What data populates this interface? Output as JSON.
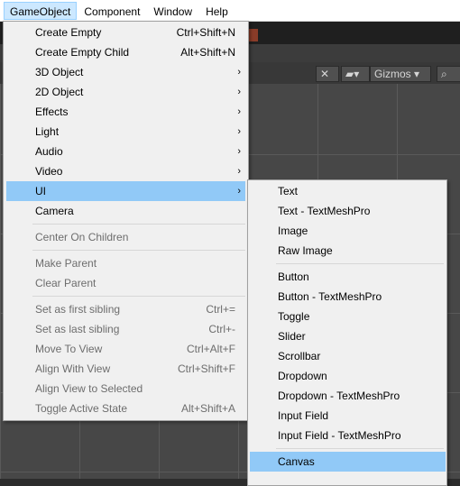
{
  "menubar": {
    "items": [
      "GameObject",
      "Component",
      "Window",
      "Help"
    ]
  },
  "scene": {
    "gizmos_label": "Gizmos"
  },
  "menu": {
    "items": [
      {
        "label": "Create Empty",
        "shortcut": "Ctrl+Shift+N"
      },
      {
        "label": "Create Empty Child",
        "shortcut": "Alt+Shift+N"
      },
      {
        "label": "3D Object",
        "submenu": true
      },
      {
        "label": "2D Object",
        "submenu": true
      },
      {
        "label": "Effects",
        "submenu": true
      },
      {
        "label": "Light",
        "submenu": true
      },
      {
        "label": "Audio",
        "submenu": true
      },
      {
        "label": "Video",
        "submenu": true
      },
      {
        "label": "UI",
        "submenu": true,
        "highlighted": true
      },
      {
        "label": "Camera"
      },
      {
        "label": "Center On Children",
        "disabled": true
      },
      {
        "label": "Make Parent",
        "disabled": true
      },
      {
        "label": "Clear Parent",
        "disabled": true
      },
      {
        "label": "Set as first sibling",
        "shortcut": "Ctrl+=",
        "disabled": true
      },
      {
        "label": "Set as last sibling",
        "shortcut": "Ctrl+-",
        "disabled": true
      },
      {
        "label": "Move To View",
        "shortcut": "Ctrl+Alt+F",
        "disabled": true
      },
      {
        "label": "Align With View",
        "shortcut": "Ctrl+Shift+F",
        "disabled": true
      },
      {
        "label": "Align View to Selected",
        "disabled": true
      },
      {
        "label": "Toggle Active State",
        "shortcut": "Alt+Shift+A",
        "disabled": true
      }
    ],
    "arrow_glyph": "›"
  },
  "submenu": {
    "items": [
      {
        "label": "Text"
      },
      {
        "label": "Text - TextMeshPro"
      },
      {
        "label": "Image"
      },
      {
        "label": "Raw Image"
      },
      {
        "label": "Button"
      },
      {
        "label": "Button - TextMeshPro"
      },
      {
        "label": "Toggle"
      },
      {
        "label": "Slider"
      },
      {
        "label": "Scrollbar"
      },
      {
        "label": "Dropdown"
      },
      {
        "label": "Dropdown - TextMeshPro"
      },
      {
        "label": "Input Field"
      },
      {
        "label": "Input Field - TextMeshPro"
      },
      {
        "label": "Canvas",
        "highlighted": true
      }
    ]
  }
}
